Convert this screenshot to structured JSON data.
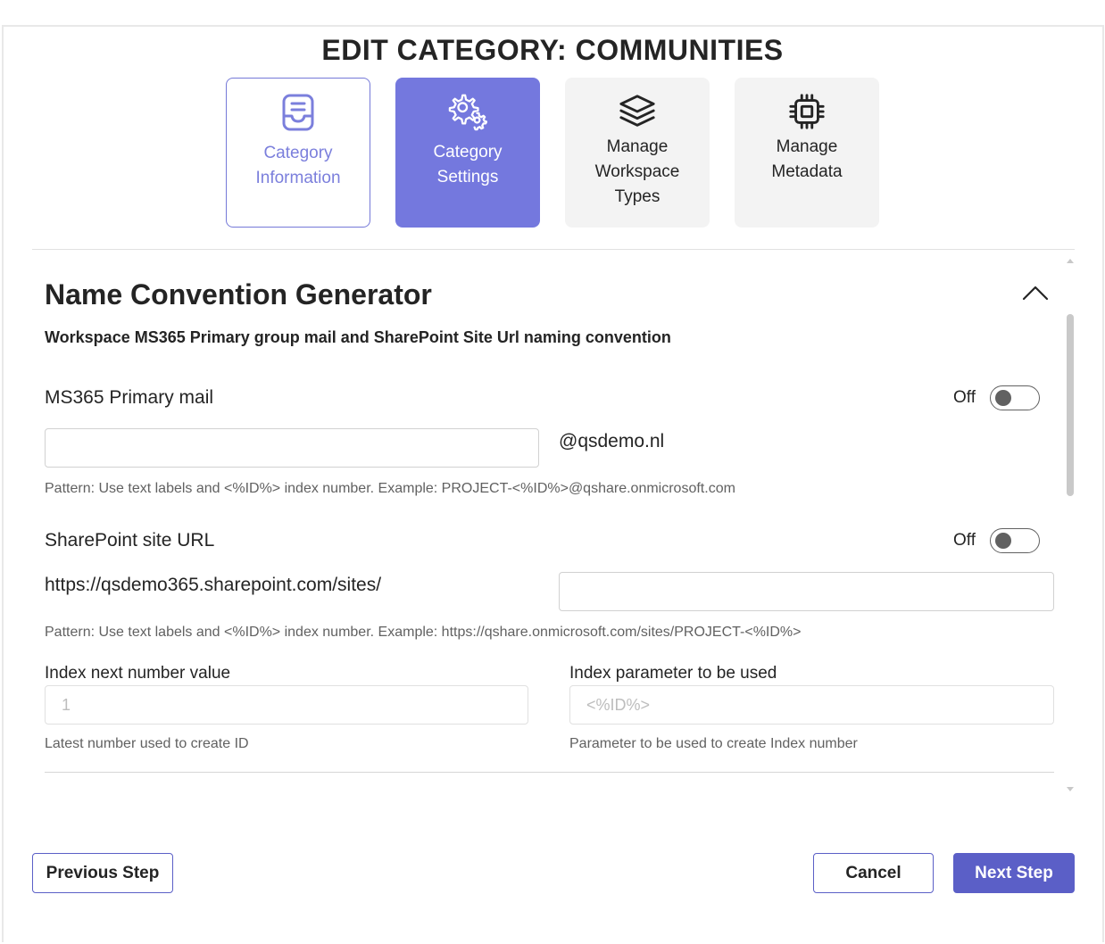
{
  "dialog": {
    "title": "EDIT CATEGORY: COMMUNITIES"
  },
  "steps": [
    {
      "label_line1": "Category",
      "label_line2": "Information",
      "label_line3": "",
      "icon": "inbox-icon",
      "state": "visited"
    },
    {
      "label_line1": "Category",
      "label_line2": "Settings",
      "label_line3": "",
      "icon": "gears-icon",
      "state": "active"
    },
    {
      "label_line1": "Manage",
      "label_line2": "Workspace",
      "label_line3": "Types",
      "icon": "layers-icon",
      "state": "pending"
    },
    {
      "label_line1": "Manage",
      "label_line2": "Metadata",
      "label_line3": "",
      "icon": "chip-icon",
      "state": "pending"
    }
  ],
  "section": {
    "title": "Name Convention Generator",
    "subtitle": "Workspace MS365 Primary group mail and SharePoint Site Url naming convention"
  },
  "primary_mail": {
    "label": "MS365 Primary mail",
    "toggle_text": "Off",
    "value": "",
    "domain_suffix": "@qsdemo.nl",
    "hint": "Pattern: Use text labels and <%ID%> index number. Example: PROJECT-<%ID%>@qshare.onmicrosoft.com"
  },
  "sharepoint_url": {
    "label": "SharePoint site URL",
    "toggle_text": "Off",
    "prefix": "https://qsdemo365.sharepoint.com/sites/",
    "value": "",
    "hint": "Pattern: Use text labels and <%ID%> index number. Example: https://qshare.onmicrosoft.com/sites/PROJECT-<%ID%>"
  },
  "index_next": {
    "label": "Index next number value",
    "value": "1",
    "hint": "Latest number used to create ID"
  },
  "index_param": {
    "label": "Index parameter to be used",
    "value": "<%ID%>",
    "hint": "Parameter to be used to create Index number"
  },
  "footer": {
    "previous_label": "Previous Step",
    "cancel_label": "Cancel",
    "next_label": "Next Step"
  },
  "colors": {
    "accent": "#5b5fc7",
    "active_step": "#7478de",
    "pending_step": "#f3f3f3"
  }
}
